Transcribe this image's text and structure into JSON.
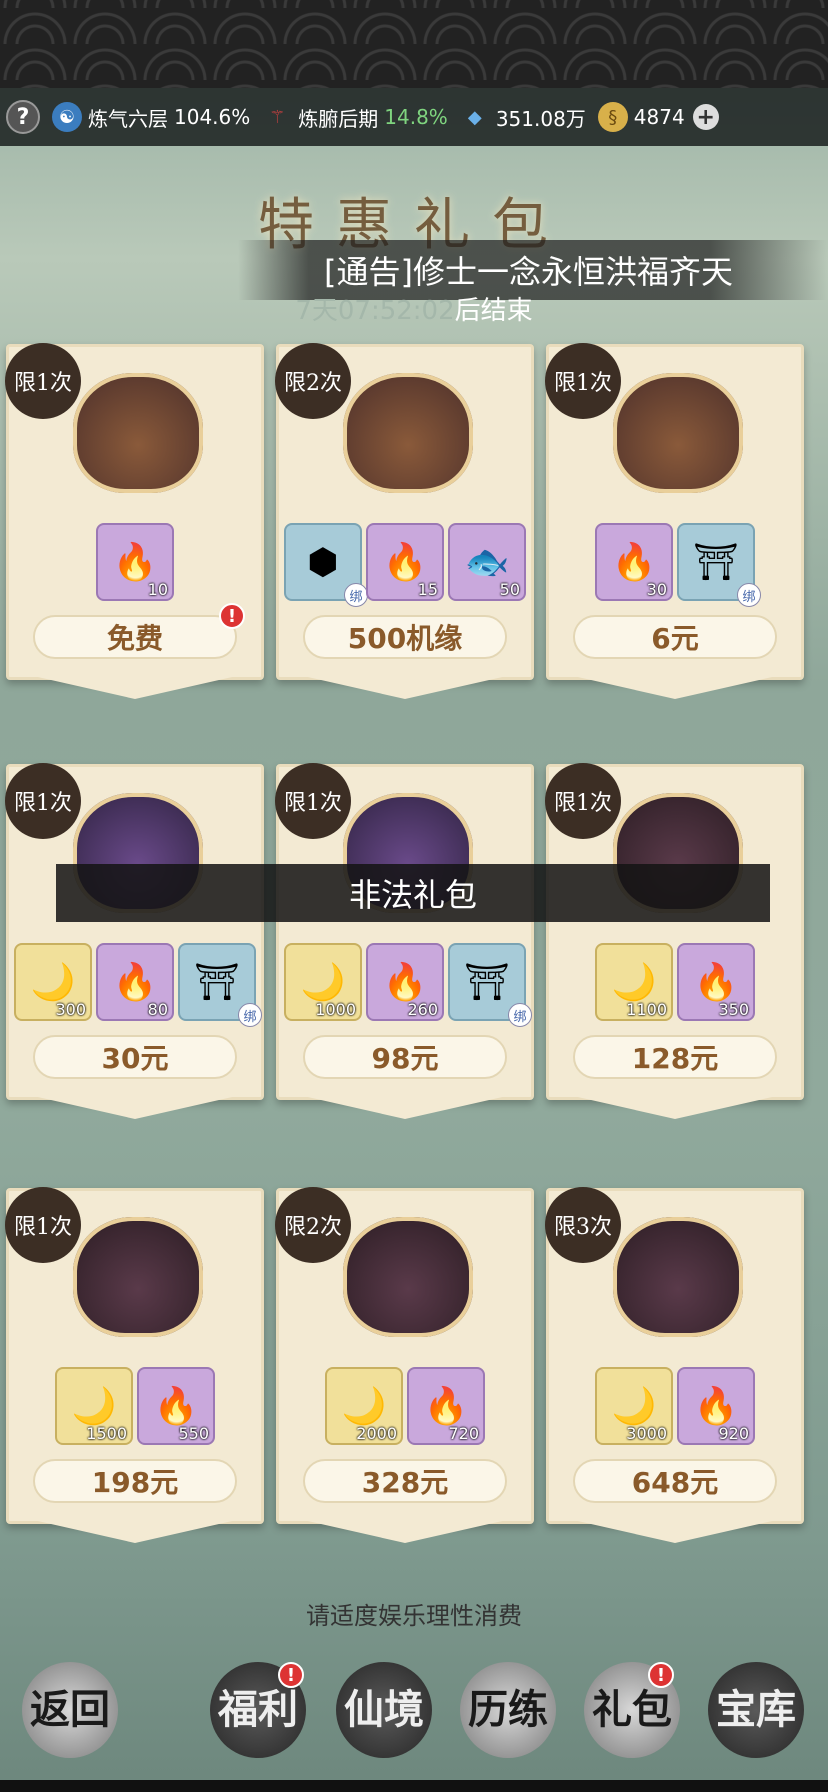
{
  "status": {
    "help": "?",
    "realm": "炼气六层",
    "realm_pct": "104.6%",
    "body": "炼腑后期",
    "body_pct": "14.8%",
    "spirit": "351.08万",
    "coins": "4874",
    "plus": "+"
  },
  "banner": {
    "title": "特惠礼包",
    "notice": "[通告]修士一念永恒洪福齐天",
    "timer_value": "7天07:52:02",
    "timer_suffix": "后结束"
  },
  "cards": [
    {
      "limit": "限1次",
      "price": "免费",
      "items": [
        {
          "qty": "10",
          "type": "flame"
        }
      ],
      "badge": "!"
    },
    {
      "limit": "限2次",
      "price": "500机缘",
      "items": [
        {
          "qty": "",
          "type": "plate",
          "bound": "绑"
        },
        {
          "qty": "15",
          "type": "flame"
        },
        {
          "qty": "50",
          "type": "fish"
        }
      ]
    },
    {
      "limit": "限1次",
      "price": "6元",
      "items": [
        {
          "qty": "30",
          "type": "flame"
        },
        {
          "qty": "",
          "type": "cauldron",
          "bound": "绑"
        }
      ]
    },
    {
      "limit": "限1次",
      "price": "30元",
      "items": [
        {
          "qty": "300",
          "type": "horn"
        },
        {
          "qty": "80",
          "type": "flame"
        },
        {
          "qty": "",
          "type": "cauldron",
          "bound": "绑"
        }
      ]
    },
    {
      "limit": "限1次",
      "price": "98元",
      "items": [
        {
          "qty": "1000",
          "type": "horn"
        },
        {
          "qty": "260",
          "type": "flame"
        },
        {
          "qty": "",
          "type": "cauldron",
          "bound": "绑"
        }
      ]
    },
    {
      "limit": "限1次",
      "price": "128元",
      "items": [
        {
          "qty": "1100",
          "type": "horn"
        },
        {
          "qty": "350",
          "type": "flame"
        }
      ]
    },
    {
      "limit": "限1次",
      "price": "198元",
      "items": [
        {
          "qty": "1500",
          "type": "horn"
        },
        {
          "qty": "550",
          "type": "flame"
        }
      ]
    },
    {
      "limit": "限2次",
      "price": "328元",
      "items": [
        {
          "qty": "2000",
          "type": "horn"
        },
        {
          "qty": "720",
          "type": "flame"
        }
      ]
    },
    {
      "limit": "限3次",
      "price": "648元",
      "items": [
        {
          "qty": "3000",
          "type": "horn"
        },
        {
          "qty": "920",
          "type": "flame"
        }
      ]
    }
  ],
  "toast": "非法礼包",
  "tip": "请适度娱乐理性消费",
  "nav": {
    "back": "返回",
    "welfare": "福利",
    "fairyland": "仙境",
    "training": "历练",
    "gift": "礼包",
    "vault": "宝库"
  }
}
